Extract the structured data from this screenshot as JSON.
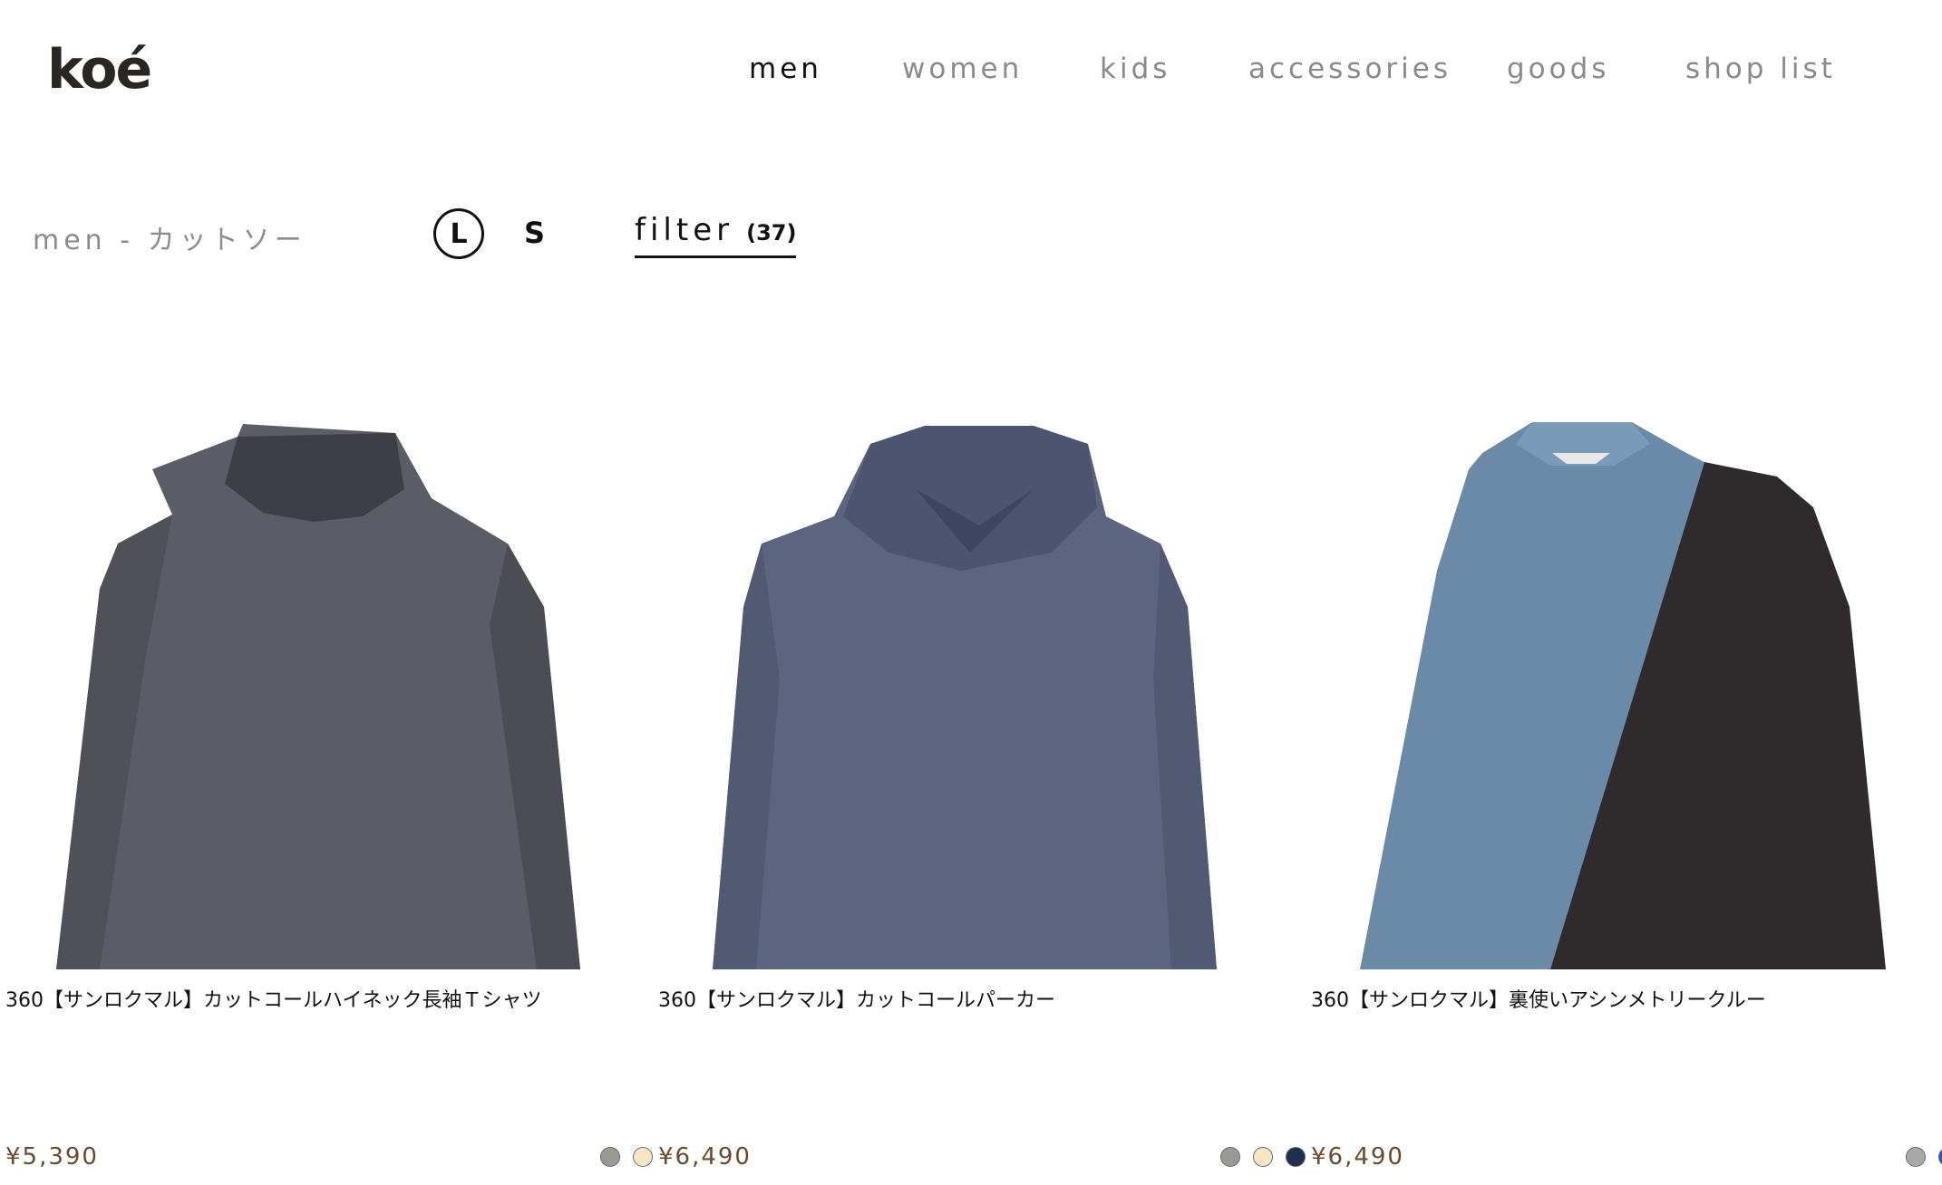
{
  "header": {
    "logo_text": "koé",
    "nav": [
      {
        "label": "men",
        "active": true
      },
      {
        "label": "women",
        "active": false
      },
      {
        "label": "kids",
        "active": false
      },
      {
        "label": "accessories",
        "active": false
      },
      {
        "label": "goods",
        "active": false
      },
      {
        "label": "shop list",
        "active": false
      }
    ]
  },
  "toolbar": {
    "breadcrumb": "men - カットソー",
    "view_large": "L",
    "view_small": "S",
    "filter_label": "filter",
    "filter_count": "(37)"
  },
  "products": [
    {
      "title": "360【サンロクマル】カットコールハイネック長袖Ｔシャツ",
      "price": "¥5,390",
      "swatches": [
        "#9a9a94",
        "#f6e6c4"
      ]
    },
    {
      "title": "360【サンロクマル】カットコールパーカー",
      "price": "¥6,490",
      "swatches": [
        "#9a9a94",
        "#f6e6c4",
        "#1e2e4e"
      ]
    },
    {
      "title": "360【サンロクマル】裏使いアシンメトリークルー",
      "price": "¥6,490",
      "swatches": [
        "#a9a9a9",
        "#2653d9"
      ]
    }
  ]
}
